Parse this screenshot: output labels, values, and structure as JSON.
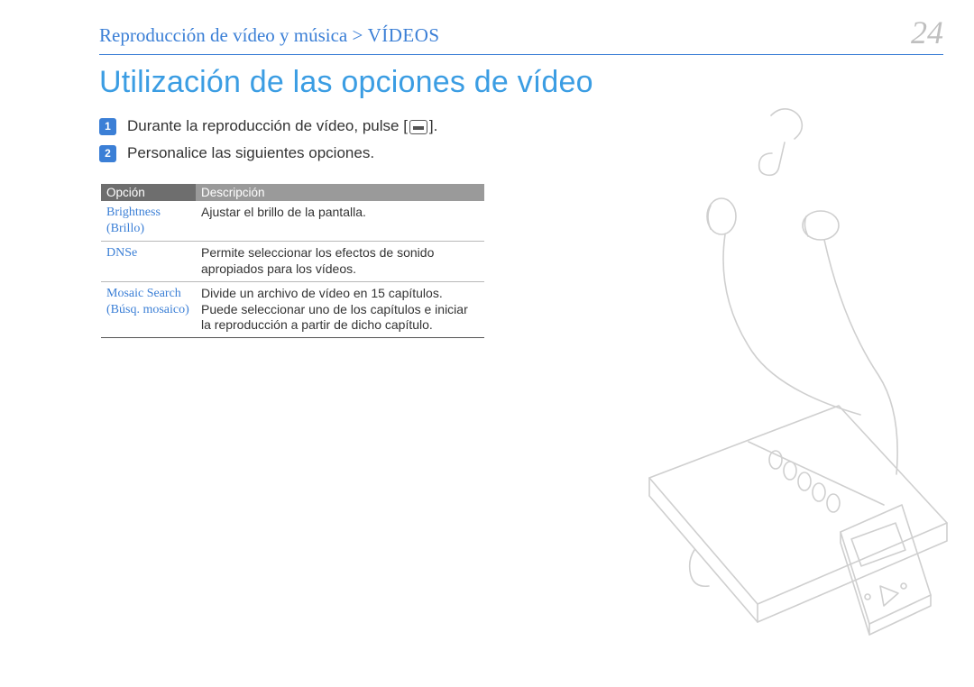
{
  "header": {
    "breadcrumb_main": "Reproducción de vídeo y música",
    "breadcrumb_sep": " > ",
    "breadcrumb_sub": "VÍDEOS",
    "page_number": "24"
  },
  "title": "Utilización de las opciones de vídeo",
  "steps": [
    {
      "num": "1",
      "text_before": "Durante la reproducción de vídeo, pulse [",
      "icon": "menu-icon",
      "text_after": "]."
    },
    {
      "num": "2",
      "text_before": "Personalice las siguientes opciones.",
      "icon": null,
      "text_after": ""
    }
  ],
  "table": {
    "headers": {
      "option": "Opción",
      "description": "Descripción"
    },
    "rows": [
      {
        "option": "Brightness (Brillo)",
        "description": "Ajustar el brillo de la pantalla."
      },
      {
        "option": "DNSe",
        "description": "Permite seleccionar los efectos de sonido apropiados para los vídeos."
      },
      {
        "option": "Mosaic Search (Búsq. mosaico)",
        "description": "Divide un archivo de vídeo en 15 capítulos. Puede seleccionar uno de los capítulos e iniciar la reproducción a partir de dicho capítulo."
      }
    ]
  },
  "illustration": "player-earbuds-notebook"
}
